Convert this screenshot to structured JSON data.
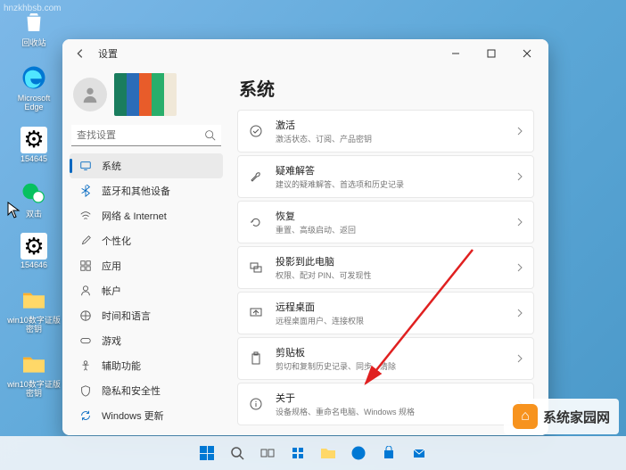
{
  "desktop": {
    "icons": [
      {
        "name": "recycle-bin",
        "label": "回收站",
        "glyph": "🗑️"
      },
      {
        "name": "edge",
        "label": "Microsoft Edge",
        "glyph": "edge"
      },
      {
        "name": "folder1",
        "label": "154645",
        "glyph": "⚙️"
      },
      {
        "name": "wechat",
        "label": "双击",
        "glyph": "wechat"
      },
      {
        "name": "folder2",
        "label": "154646",
        "glyph": "📁"
      },
      {
        "name": "folder3",
        "label": "win10数字证版密钥",
        "glyph": "📁"
      },
      {
        "name": "folder4",
        "label": "win10数字证版密钥",
        "glyph": "📁"
      }
    ]
  },
  "window": {
    "title": "设置",
    "search": {
      "placeholder": "查找设置"
    },
    "nav": [
      {
        "name": "system",
        "label": "系统",
        "active": true
      },
      {
        "name": "bluetooth",
        "label": "蓝牙和其他设备"
      },
      {
        "name": "network",
        "label": "网络 & Internet"
      },
      {
        "name": "personalization",
        "label": "个性化"
      },
      {
        "name": "apps",
        "label": "应用"
      },
      {
        "name": "accounts",
        "label": "帐户"
      },
      {
        "name": "time-language",
        "label": "时间和语言"
      },
      {
        "name": "gaming",
        "label": "游戏"
      },
      {
        "name": "accessibility",
        "label": "辅助功能"
      },
      {
        "name": "privacy",
        "label": "隐私和安全性"
      },
      {
        "name": "windows-update",
        "label": "Windows 更新"
      }
    ],
    "main": {
      "title": "系统",
      "cards": [
        {
          "name": "activation",
          "title": "激活",
          "sub": "激活状态、订阅、产品密钥"
        },
        {
          "name": "troubleshoot",
          "title": "疑难解答",
          "sub": "建议的疑难解答、首选项和历史记录"
        },
        {
          "name": "recovery",
          "title": "恢复",
          "sub": "重置、高级启动、返回"
        },
        {
          "name": "project",
          "title": "投影到此电脑",
          "sub": "权限、配对 PIN、可发现性"
        },
        {
          "name": "remote-desktop",
          "title": "远程桌面",
          "sub": "远程桌面用户、连接权限"
        },
        {
          "name": "clipboard",
          "title": "剪贴板",
          "sub": "剪切和复制历史记录、同步、清除"
        },
        {
          "name": "about",
          "title": "关于",
          "sub": "设备规格、重命名电脑、Windows 规格"
        }
      ]
    }
  },
  "watermarks": {
    "topleft": "hnzkhbsb.com",
    "bottomright": "系统家园网"
  }
}
